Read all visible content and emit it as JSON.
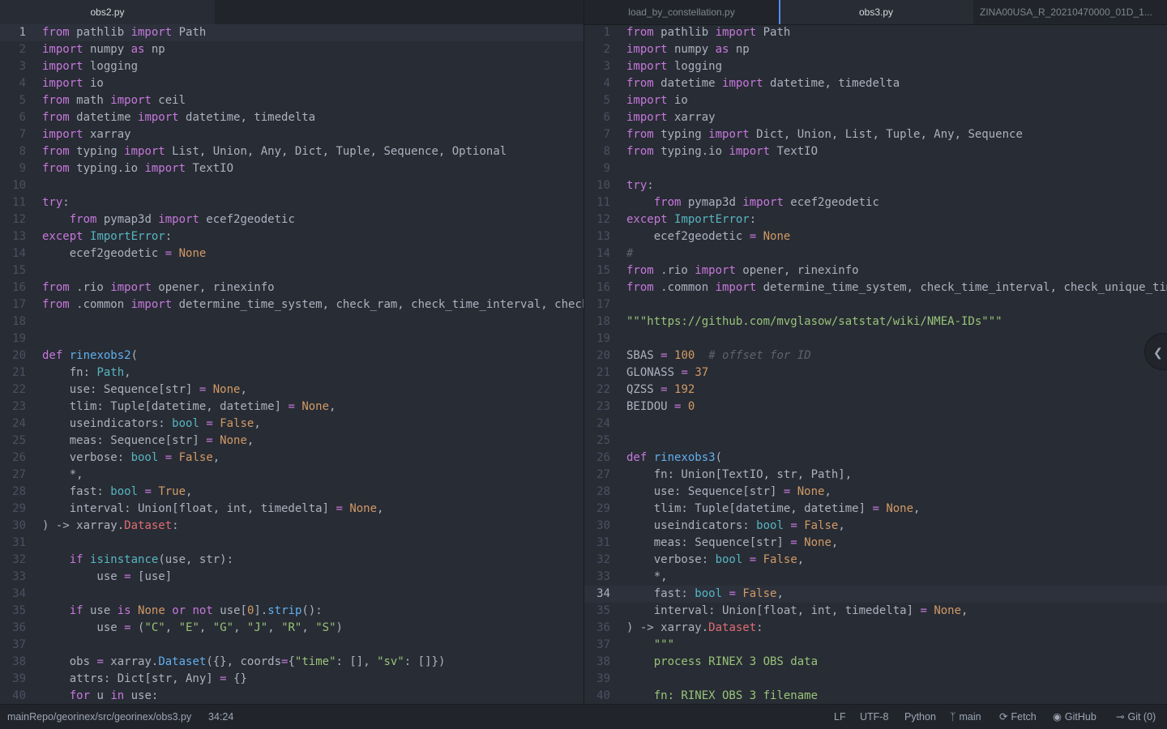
{
  "left_pane": {
    "tabs": [
      {
        "label": "obs2.py",
        "active": true
      }
    ],
    "lines": [
      [
        [
          "k",
          "from"
        ],
        [
          "p",
          " pathlib "
        ],
        [
          "k",
          "import"
        ],
        [
          "p",
          " Path"
        ]
      ],
      [
        [
          "k",
          "import"
        ],
        [
          "p",
          " numpy "
        ],
        [
          "k",
          "as"
        ],
        [
          "p",
          " np"
        ]
      ],
      [
        [
          "k",
          "import"
        ],
        [
          "p",
          " logging"
        ]
      ],
      [
        [
          "k",
          "import"
        ],
        [
          "p",
          " io"
        ]
      ],
      [
        [
          "k",
          "from"
        ],
        [
          "p",
          " math "
        ],
        [
          "k",
          "import"
        ],
        [
          "p",
          " ceil"
        ]
      ],
      [
        [
          "k",
          "from"
        ],
        [
          "p",
          " datetime "
        ],
        [
          "k",
          "import"
        ],
        [
          "p",
          " datetime, timedelta"
        ]
      ],
      [
        [
          "k",
          "import"
        ],
        [
          "p",
          " xarray"
        ]
      ],
      [
        [
          "k",
          "from"
        ],
        [
          "p",
          " typing "
        ],
        [
          "k",
          "import"
        ],
        [
          "p",
          " List, Union, Any, Dict, Tuple, Sequence, Optional"
        ]
      ],
      [
        [
          "k",
          "from"
        ],
        [
          "p",
          " typing.io "
        ],
        [
          "k",
          "import"
        ],
        [
          "p",
          " TextIO"
        ]
      ],
      [],
      [
        [
          "k",
          "try"
        ],
        [
          "p",
          ":"
        ]
      ],
      [
        [
          "p",
          "    "
        ],
        [
          "k",
          "from"
        ],
        [
          "p",
          " pymap3d "
        ],
        [
          "k",
          "import"
        ],
        [
          "p",
          " ecef2geodetic"
        ]
      ],
      [
        [
          "k",
          "except"
        ],
        [
          "p",
          " "
        ],
        [
          "b",
          "ImportError"
        ],
        [
          "p",
          ":"
        ]
      ],
      [
        [
          "p",
          "    ecef2geodetic "
        ],
        [
          "k",
          "="
        ],
        [
          "p",
          " "
        ],
        [
          "n",
          "None"
        ]
      ],
      [],
      [
        [
          "k",
          "from"
        ],
        [
          "p",
          " .rio "
        ],
        [
          "k",
          "import"
        ],
        [
          "p",
          " opener, rinexinfo"
        ]
      ],
      [
        [
          "k",
          "from"
        ],
        [
          "p",
          " .common "
        ],
        [
          "k",
          "import"
        ],
        [
          "p",
          " determine_time_system, check_ram, check_time_interval, check_unique_times"
        ]
      ],
      [],
      [],
      [
        [
          "k",
          "def"
        ],
        [
          "p",
          " "
        ],
        [
          "f",
          "rinexobs2"
        ],
        [
          "p",
          "("
        ]
      ],
      [
        [
          "p",
          "    fn: "
        ],
        [
          "b",
          "Path"
        ],
        [
          "p",
          ","
        ]
      ],
      [
        [
          "p",
          "    use: Sequence[str] "
        ],
        [
          "k",
          "="
        ],
        [
          "p",
          " "
        ],
        [
          "n",
          "None"
        ],
        [
          "p",
          ","
        ]
      ],
      [
        [
          "p",
          "    tlim: Tuple[datetime, datetime] "
        ],
        [
          "k",
          "="
        ],
        [
          "p",
          " "
        ],
        [
          "n",
          "None"
        ],
        [
          "p",
          ","
        ]
      ],
      [
        [
          "p",
          "    useindicators: "
        ],
        [
          "b",
          "bool"
        ],
        [
          "p",
          " "
        ],
        [
          "k",
          "="
        ],
        [
          "p",
          " "
        ],
        [
          "n",
          "False"
        ],
        [
          "p",
          ","
        ]
      ],
      [
        [
          "p",
          "    meas: Sequence[str] "
        ],
        [
          "k",
          "="
        ],
        [
          "p",
          " "
        ],
        [
          "n",
          "None"
        ],
        [
          "p",
          ","
        ]
      ],
      [
        [
          "p",
          "    verbose: "
        ],
        [
          "b",
          "bool"
        ],
        [
          "p",
          " "
        ],
        [
          "k",
          "="
        ],
        [
          "p",
          " "
        ],
        [
          "n",
          "False"
        ],
        [
          "p",
          ","
        ]
      ],
      [
        [
          "p",
          "    *,"
        ]
      ],
      [
        [
          "p",
          "    fast: "
        ],
        [
          "b",
          "bool"
        ],
        [
          "p",
          " "
        ],
        [
          "k",
          "="
        ],
        [
          "p",
          " "
        ],
        [
          "n",
          "True"
        ],
        [
          "p",
          ","
        ]
      ],
      [
        [
          "p",
          "    interval: Union[float, int, timedelta] "
        ],
        [
          "k",
          "="
        ],
        [
          "p",
          " "
        ],
        [
          "n",
          "None"
        ],
        [
          "p",
          ","
        ]
      ],
      [
        [
          "p",
          ") -> xarray."
        ],
        [
          "r",
          "Dataset"
        ],
        [
          "p",
          ":"
        ]
      ],
      [],
      [
        [
          "p",
          "    "
        ],
        [
          "k",
          "if"
        ],
        [
          "p",
          " "
        ],
        [
          "b",
          "isinstance"
        ],
        [
          "p",
          "(use, str):"
        ]
      ],
      [
        [
          "p",
          "        use "
        ],
        [
          "k",
          "="
        ],
        [
          "p",
          " [use]"
        ]
      ],
      [],
      [
        [
          "p",
          "    "
        ],
        [
          "k",
          "if"
        ],
        [
          "p",
          " use "
        ],
        [
          "k",
          "is"
        ],
        [
          "p",
          " "
        ],
        [
          "n",
          "None"
        ],
        [
          "p",
          " "
        ],
        [
          "k",
          "or"
        ],
        [
          "p",
          " "
        ],
        [
          "k",
          "not"
        ],
        [
          "p",
          " use["
        ],
        [
          "n",
          "0"
        ],
        [
          "p",
          "]."
        ],
        [
          "f",
          "strip"
        ],
        [
          "p",
          "():"
        ]
      ],
      [
        [
          "p",
          "        use "
        ],
        [
          "k",
          "="
        ],
        [
          "p",
          " ("
        ],
        [
          "s",
          "\"C\""
        ],
        [
          "p",
          ", "
        ],
        [
          "s",
          "\"E\""
        ],
        [
          "p",
          ", "
        ],
        [
          "s",
          "\"G\""
        ],
        [
          "p",
          ", "
        ],
        [
          "s",
          "\"J\""
        ],
        [
          "p",
          ", "
        ],
        [
          "s",
          "\"R\""
        ],
        [
          "p",
          ", "
        ],
        [
          "s",
          "\"S\""
        ],
        [
          "p",
          ")"
        ]
      ],
      [],
      [
        [
          "p",
          "    obs "
        ],
        [
          "k",
          "="
        ],
        [
          "p",
          " xarray."
        ],
        [
          "f",
          "Dataset"
        ],
        [
          "p",
          "({}, coords"
        ],
        [
          "k",
          "="
        ],
        [
          "p",
          "{"
        ],
        [
          "s",
          "\"time\""
        ],
        [
          "p",
          ": [], "
        ],
        [
          "s",
          "\"sv\""
        ],
        [
          "p",
          ": []})"
        ]
      ],
      [
        [
          "p",
          "    attrs: Dict[str, Any] "
        ],
        [
          "k",
          "="
        ],
        [
          "p",
          " {}"
        ]
      ],
      [
        [
          "p",
          "    "
        ],
        [
          "k",
          "for"
        ],
        [
          "p",
          " u "
        ],
        [
          "k",
          "in"
        ],
        [
          "p",
          " use:"
        ]
      ]
    ],
    "cursor_line": 0
  },
  "right_pane": {
    "tabs": [
      {
        "label": "load_by_constellation.py",
        "active": false
      },
      {
        "label": "obs3.py",
        "active": true
      },
      {
        "label": "ZINA00USA_R_20210470000_01D_1...",
        "active": false
      }
    ],
    "lines": [
      [
        [
          "k",
          "from"
        ],
        [
          "p",
          " pathlib "
        ],
        [
          "k",
          "import"
        ],
        [
          "p",
          " Path"
        ]
      ],
      [
        [
          "k",
          "import"
        ],
        [
          "p",
          " numpy "
        ],
        [
          "k",
          "as"
        ],
        [
          "p",
          " np"
        ]
      ],
      [
        [
          "k",
          "import"
        ],
        [
          "p",
          " logging"
        ]
      ],
      [
        [
          "k",
          "from"
        ],
        [
          "p",
          " datetime "
        ],
        [
          "k",
          "import"
        ],
        [
          "p",
          " datetime, timedelta"
        ]
      ],
      [
        [
          "k",
          "import"
        ],
        [
          "p",
          " io"
        ]
      ],
      [
        [
          "k",
          "import"
        ],
        [
          "p",
          " xarray"
        ]
      ],
      [
        [
          "k",
          "from"
        ],
        [
          "p",
          " typing "
        ],
        [
          "k",
          "import"
        ],
        [
          "p",
          " Dict, Union, List, Tuple, Any, Sequence"
        ]
      ],
      [
        [
          "k",
          "from"
        ],
        [
          "p",
          " typing.io "
        ],
        [
          "k",
          "import"
        ],
        [
          "p",
          " TextIO"
        ]
      ],
      [],
      [
        [
          "k",
          "try"
        ],
        [
          "p",
          ":"
        ]
      ],
      [
        [
          "p",
          "    "
        ],
        [
          "k",
          "from"
        ],
        [
          "p",
          " pymap3d "
        ],
        [
          "k",
          "import"
        ],
        [
          "p",
          " ecef2geodetic"
        ]
      ],
      [
        [
          "k",
          "except"
        ],
        [
          "p",
          " "
        ],
        [
          "b",
          "ImportError"
        ],
        [
          "p",
          ":"
        ]
      ],
      [
        [
          "p",
          "    ecef2geodetic "
        ],
        [
          "k",
          "="
        ],
        [
          "p",
          " "
        ],
        [
          "n",
          "None"
        ]
      ],
      [
        [
          "c",
          "#"
        ]
      ],
      [
        [
          "k",
          "from"
        ],
        [
          "p",
          " .rio "
        ],
        [
          "k",
          "import"
        ],
        [
          "p",
          " opener, rinexinfo"
        ]
      ],
      [
        [
          "k",
          "from"
        ],
        [
          "p",
          " .common "
        ],
        [
          "k",
          "import"
        ],
        [
          "p",
          " determine_time_system, check_time_interval, check_unique_times"
        ]
      ],
      [],
      [
        [
          "s",
          "\"\"\"https://github.com/mvglasow/satstat/wiki/NMEA-IDs\"\"\""
        ]
      ],
      [],
      [
        [
          "p",
          "SBAS "
        ],
        [
          "k",
          "="
        ],
        [
          "p",
          " "
        ],
        [
          "n",
          "100"
        ],
        [
          "p",
          "  "
        ],
        [
          "c",
          "# offset for ID"
        ]
      ],
      [
        [
          "p",
          "GLONASS "
        ],
        [
          "k",
          "="
        ],
        [
          "p",
          " "
        ],
        [
          "n",
          "37"
        ]
      ],
      [
        [
          "p",
          "QZSS "
        ],
        [
          "k",
          "="
        ],
        [
          "p",
          " "
        ],
        [
          "n",
          "192"
        ]
      ],
      [
        [
          "p",
          "BEIDOU "
        ],
        [
          "k",
          "="
        ],
        [
          "p",
          " "
        ],
        [
          "n",
          "0"
        ]
      ],
      [],
      [],
      [
        [
          "k",
          "def"
        ],
        [
          "p",
          " "
        ],
        [
          "f",
          "rinexobs3"
        ],
        [
          "p",
          "("
        ]
      ],
      [
        [
          "p",
          "    fn: Union[TextIO, str, Path],"
        ]
      ],
      [
        [
          "p",
          "    use: Sequence[str] "
        ],
        [
          "k",
          "="
        ],
        [
          "p",
          " "
        ],
        [
          "n",
          "None"
        ],
        [
          "p",
          ","
        ]
      ],
      [
        [
          "p",
          "    tlim: Tuple[datetime, datetime] "
        ],
        [
          "k",
          "="
        ],
        [
          "p",
          " "
        ],
        [
          "n",
          "None"
        ],
        [
          "p",
          ","
        ]
      ],
      [
        [
          "p",
          "    useindicators: "
        ],
        [
          "b",
          "bool"
        ],
        [
          "p",
          " "
        ],
        [
          "k",
          "="
        ],
        [
          "p",
          " "
        ],
        [
          "n",
          "False"
        ],
        [
          "p",
          ","
        ]
      ],
      [
        [
          "p",
          "    meas: Sequence[str] "
        ],
        [
          "k",
          "="
        ],
        [
          "p",
          " "
        ],
        [
          "n",
          "None"
        ],
        [
          "p",
          ","
        ]
      ],
      [
        [
          "p",
          "    verbose: "
        ],
        [
          "b",
          "bool"
        ],
        [
          "p",
          " "
        ],
        [
          "k",
          "="
        ],
        [
          "p",
          " "
        ],
        [
          "n",
          "False"
        ],
        [
          "p",
          ","
        ]
      ],
      [
        [
          "p",
          "    *,"
        ]
      ],
      [
        [
          "p",
          "    fast: "
        ],
        [
          "b",
          "bool"
        ],
        [
          "p",
          " "
        ],
        [
          "k",
          "="
        ],
        [
          "p",
          " "
        ],
        [
          "n",
          "False"
        ],
        [
          "p",
          ","
        ]
      ],
      [
        [
          "p",
          "    interval: Union[float, int, timedelta] "
        ],
        [
          "k",
          "="
        ],
        [
          "p",
          " "
        ],
        [
          "n",
          "None"
        ],
        [
          "p",
          ","
        ]
      ],
      [
        [
          "p",
          ") -> xarray."
        ],
        [
          "r",
          "Dataset"
        ],
        [
          "p",
          ":"
        ]
      ],
      [
        [
          "s",
          "    \"\"\""
        ]
      ],
      [
        [
          "s",
          "    process RINEX 3 OBS data"
        ]
      ],
      [],
      [
        [
          "s",
          "    fn: RINEX OBS 3 filename"
        ]
      ]
    ],
    "cursor_line": 33
  },
  "collapse_icon": "chevron-left-icon",
  "status_bar": {
    "path": "mainRepo/georinex/src/georinex/obs3.py",
    "cursor": "34:24",
    "line_ending": "LF",
    "encoding": "UTF-8",
    "grammar": "Python",
    "branch": "main",
    "fetch": "Fetch",
    "github": "GitHub",
    "git": "Git (0)"
  },
  "colors": {
    "background": "#282c34",
    "panel": "#21252b",
    "keyword": "#c678dd",
    "function": "#61afef",
    "builtin": "#56b6c2",
    "number": "#d19a66",
    "string": "#98c379",
    "comment": "#5c6370",
    "accent": "#568af2"
  }
}
